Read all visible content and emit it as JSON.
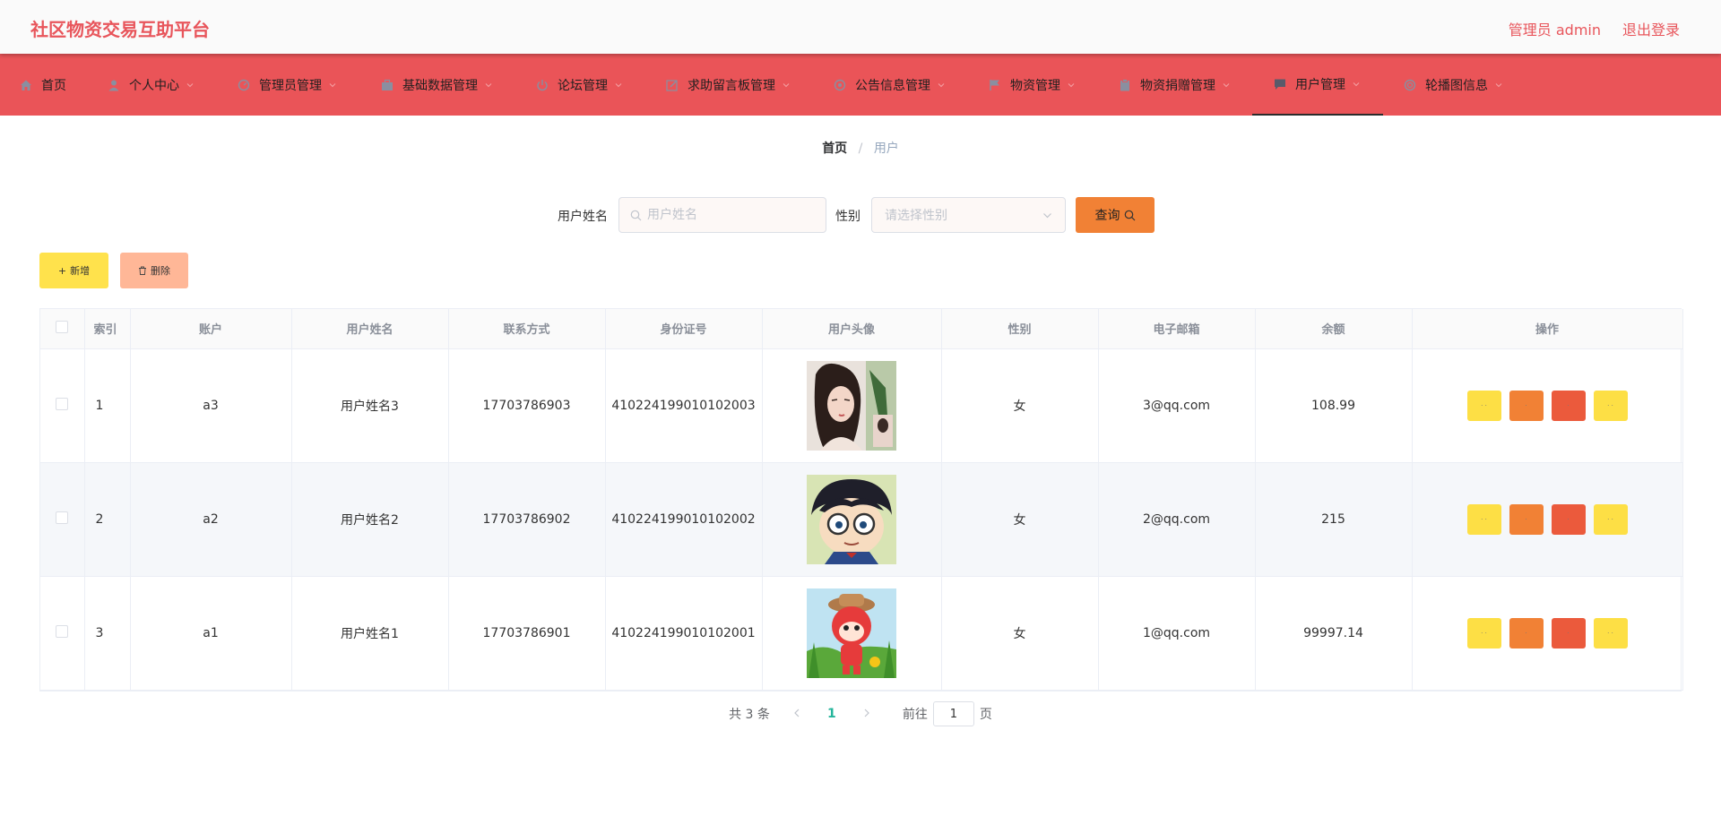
{
  "header": {
    "title": "社区物资交易互助平台",
    "user_role": "管理员 admin",
    "logout": "退出登录"
  },
  "nav": {
    "items": [
      {
        "label": "首页",
        "icon": "home-icon"
      },
      {
        "label": "个人中心",
        "icon": "user-icon"
      },
      {
        "label": "管理员管理",
        "icon": "gauge-icon"
      },
      {
        "label": "基础数据管理",
        "icon": "briefcase-icon"
      },
      {
        "label": "论坛管理",
        "icon": "power-icon"
      },
      {
        "label": "求助留言板管理",
        "icon": "edit-icon"
      },
      {
        "label": "公告信息管理",
        "icon": "aperture-icon"
      },
      {
        "label": "物资管理",
        "icon": "flag-icon"
      },
      {
        "label": "物资捐赠管理",
        "icon": "clipboard-icon"
      },
      {
        "label": "用户管理",
        "icon": "chat-icon"
      },
      {
        "label": "轮播图信息",
        "icon": "target-icon"
      }
    ],
    "active": "用户管理"
  },
  "breadcrumb": {
    "home": "首页",
    "separator": "/",
    "current": "用户"
  },
  "search": {
    "name_label": "用户姓名",
    "name_placeholder": "用户姓名",
    "gender_label": "性别",
    "gender_placeholder": "请选择性别",
    "query_label": "查询"
  },
  "actions": {
    "add_label": "新增",
    "delete_label": "删除"
  },
  "table": {
    "headers": [
      "索引",
      "账户",
      "用户姓名",
      "联系方式",
      "身份证号",
      "用户头像",
      "性别",
      "电子邮箱",
      "余额",
      "操作"
    ],
    "rows": [
      {
        "index": "1",
        "account": "a3",
        "name": "用户姓名3",
        "phone": "17703786903",
        "id_number": "410224199010102003",
        "avatar": "girl-portrait-avatar",
        "gender": "女",
        "email": "3@qq.com",
        "balance": "108.99"
      },
      {
        "index": "2",
        "account": "a2",
        "name": "用户姓名2",
        "phone": "17703786902",
        "id_number": "410224199010102002",
        "avatar": "cartoon-boy-glasses-avatar",
        "gender": "女",
        "email": "2@qq.com",
        "balance": "215"
      },
      {
        "index": "3",
        "account": "a1",
        "name": "用户姓名1",
        "phone": "17703786901",
        "id_number": "410224199010102001",
        "avatar": "cartoon-red-character-avatar",
        "gender": "女",
        "email": "1@qq.com",
        "balance": "99997.14"
      }
    ],
    "op_buttons": [
      {
        "name": "detail-button",
        "color": "#fddf45",
        "label": "· ·"
      },
      {
        "name": "edit-button",
        "color": "#f18135",
        "label": "·"
      },
      {
        "name": "delete-button",
        "color": "#eb5a3c",
        "label": "·"
      },
      {
        "name": "more-button",
        "color": "#fddf45",
        "label": "· ·"
      }
    ]
  },
  "pagination": {
    "total": "共 3 条",
    "current_page": "1",
    "goto_label": "前往",
    "goto_value": "1",
    "page_suffix": "页"
  },
  "colors": {
    "accent": "#ea5458",
    "title": "#e8555b",
    "query": "#f18135",
    "add": "#ffe24c",
    "delete": "#ffb797",
    "page_active": "#25b59b"
  }
}
